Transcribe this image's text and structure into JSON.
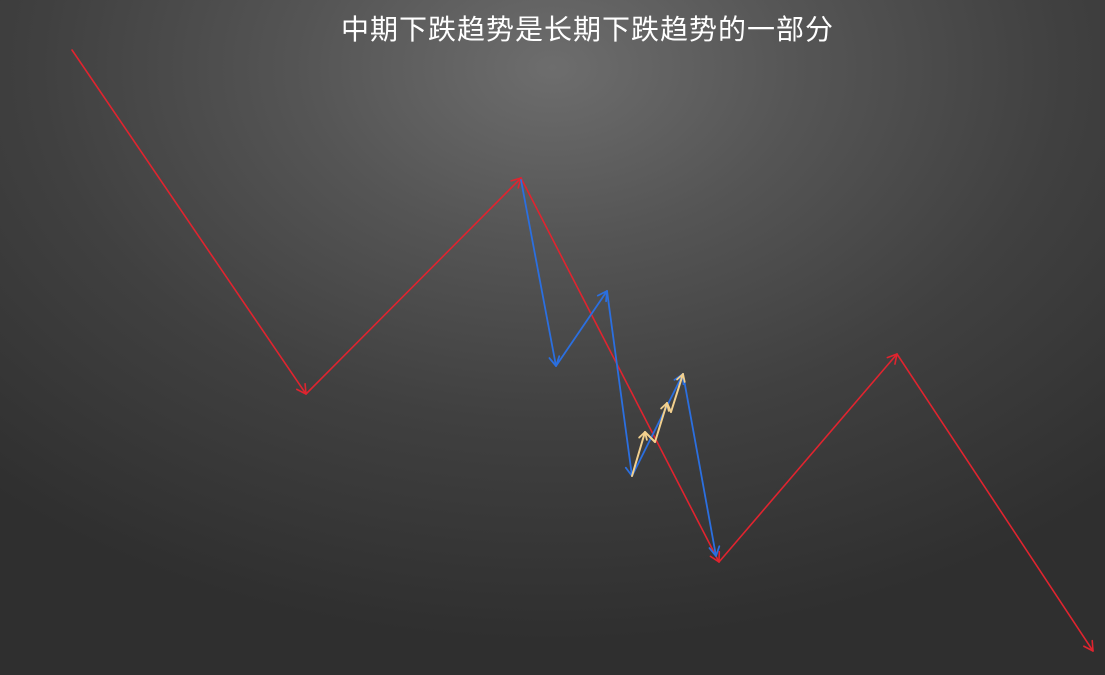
{
  "title": "中期下跌趋势是长期下跌趋势的一部分",
  "colors": {
    "long_term": "#e0242f",
    "medium_term": "#2b6fe0",
    "short_term": "#f2d08e",
    "background": "#4a4a4a",
    "title_text": "#ffffff"
  },
  "legs": [
    {
      "name": "long-term-leg-1",
      "color": "long_term",
      "direction": "down"
    },
    {
      "name": "long-term-leg-2",
      "color": "long_term",
      "direction": "up"
    },
    {
      "name": "long-term-leg-3",
      "color": "long_term",
      "direction": "down"
    },
    {
      "name": "long-term-leg-4",
      "color": "long_term",
      "direction": "up"
    },
    {
      "name": "long-term-leg-5",
      "color": "long_term",
      "direction": "down"
    },
    {
      "name": "medium-term-leg-1",
      "color": "medium_term",
      "direction": "down"
    },
    {
      "name": "medium-term-leg-2",
      "color": "medium_term",
      "direction": "up"
    },
    {
      "name": "medium-term-leg-3",
      "color": "medium_term",
      "direction": "down"
    },
    {
      "name": "medium-term-leg-4",
      "color": "medium_term",
      "direction": "up"
    },
    {
      "name": "medium-term-leg-5",
      "color": "medium_term",
      "direction": "down"
    },
    {
      "name": "short-term-leg-1",
      "color": "short_term",
      "direction": "up"
    },
    {
      "name": "short-term-leg-2",
      "color": "short_term",
      "direction": "down"
    },
    {
      "name": "short-term-leg-3",
      "color": "short_term",
      "direction": "up"
    },
    {
      "name": "short-term-leg-4",
      "color": "short_term",
      "direction": "down"
    },
    {
      "name": "short-term-leg-5",
      "color": "short_term",
      "direction": "up"
    }
  ]
}
